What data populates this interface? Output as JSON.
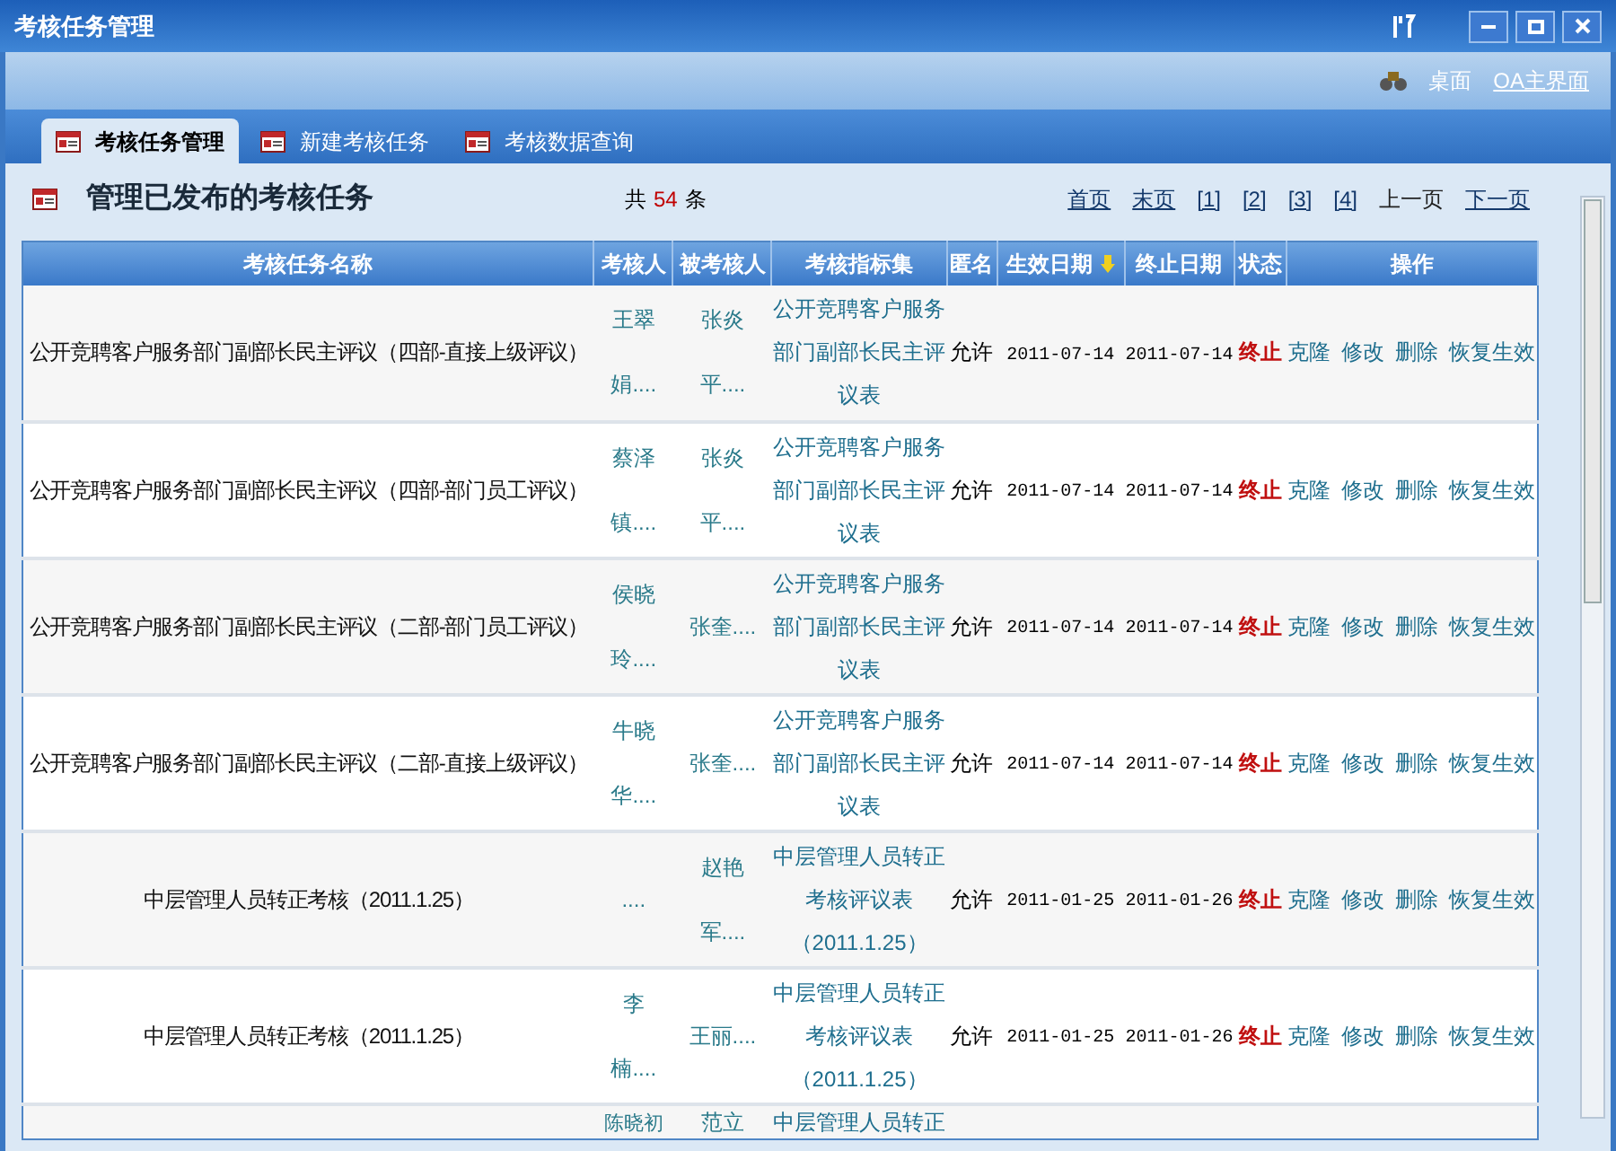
{
  "window": {
    "title": "考核任务管理"
  },
  "toolbar": {
    "links": [
      {
        "label": "桌面",
        "underlined": false
      },
      {
        "label": "OA主界面",
        "underlined": true
      }
    ]
  },
  "tabs": [
    {
      "label": "考核任务管理",
      "selected": true
    },
    {
      "label": "新建考核任务",
      "selected": false
    },
    {
      "label": "考核数据查询",
      "selected": false
    }
  ],
  "heading": "管理已发布的考核任务",
  "count": {
    "prefix": "共",
    "value": "54",
    "suffix": "条"
  },
  "pager": [
    {
      "label": "首页",
      "disabled": false
    },
    {
      "label": "末页",
      "disabled": false
    },
    {
      "label": "[1]",
      "disabled": false
    },
    {
      "label": "[2]",
      "disabled": false
    },
    {
      "label": "[3]",
      "disabled": false
    },
    {
      "label": "[4]",
      "disabled": false
    },
    {
      "label": "上一页",
      "disabled": true
    },
    {
      "label": "下一页",
      "disabled": false
    }
  ],
  "table": {
    "columns": [
      {
        "label": "考核任务名称",
        "sorted": false
      },
      {
        "label": "考核人",
        "sorted": false
      },
      {
        "label": "被考核人",
        "sorted": false
      },
      {
        "label": "考核指标集",
        "sorted": false
      },
      {
        "label": "匿名",
        "sorted": false
      },
      {
        "label": "生效日期",
        "sorted": true
      },
      {
        "label": "终止日期",
        "sorted": false
      },
      {
        "label": "状态",
        "sorted": false
      },
      {
        "label": "操作",
        "sorted": false
      }
    ],
    "rows": [
      {
        "name": "公开竞聘客户服务部门副部长民主评议（四部-直接上级评议）",
        "assessor": "王翠娟....",
        "assessee": "张炎平....",
        "indicator": "公开竞聘客户服务部门副部长民主评议表",
        "anonymous": "允许",
        "start": "2011-07-14",
        "end": "2011-07-14",
        "status": "终止",
        "actions": [
          "克隆",
          "修改",
          "删除",
          "恢复生效"
        ]
      },
      {
        "name": "公开竞聘客户服务部门副部长民主评议（四部-部门员工评议）",
        "assessor": "蔡泽镇....",
        "assessee": "张炎平....",
        "indicator": "公开竞聘客户服务部门副部长民主评议表",
        "anonymous": "允许",
        "start": "2011-07-14",
        "end": "2011-07-14",
        "status": "终止",
        "actions": [
          "克隆",
          "修改",
          "删除",
          "恢复生效"
        ]
      },
      {
        "name": "公开竞聘客户服务部门副部长民主评议（二部-部门员工评议）",
        "assessor": "侯晓玲....",
        "assessee": "张奎....",
        "indicator": "公开竞聘客户服务部门副部长民主评议表",
        "anonymous": "允许",
        "start": "2011-07-14",
        "end": "2011-07-14",
        "status": "终止",
        "actions": [
          "克隆",
          "修改",
          "删除",
          "恢复生效"
        ]
      },
      {
        "name": "公开竞聘客户服务部门副部长民主评议（二部-直接上级评议）",
        "assessor": "牛晓华....",
        "assessee": "张奎....",
        "indicator": "公开竞聘客户服务部门副部长民主评议表",
        "anonymous": "允许",
        "start": "2011-07-14",
        "end": "2011-07-14",
        "status": "终止",
        "actions": [
          "克隆",
          "修改",
          "删除",
          "恢复生效"
        ]
      },
      {
        "name": "中层管理人员转正考核（2011.1.25）",
        "assessor": "....",
        "assessee": "赵艳军....",
        "indicator": "中层管理人员转正考核评议表（2011.1.25）",
        "anonymous": "允许",
        "start": "2011-01-25",
        "end": "2011-01-26",
        "status": "终止",
        "actions": [
          "克隆",
          "修改",
          "删除",
          "恢复生效"
        ]
      },
      {
        "name": "中层管理人员转正考核（2011.1.25）",
        "assessor": "李楠....",
        "assessee": "王丽....",
        "indicator": "中层管理人员转正考核评议表（2011.1.25）",
        "anonymous": "允许",
        "start": "2011-01-25",
        "end": "2011-01-26",
        "status": "终止",
        "actions": [
          "克隆",
          "修改",
          "删除",
          "恢复生效"
        ]
      }
    ],
    "partial_row": {
      "assessor": "陈晓初",
      "assessee": "范立",
      "indicator": "中层管理人员转正"
    }
  }
}
